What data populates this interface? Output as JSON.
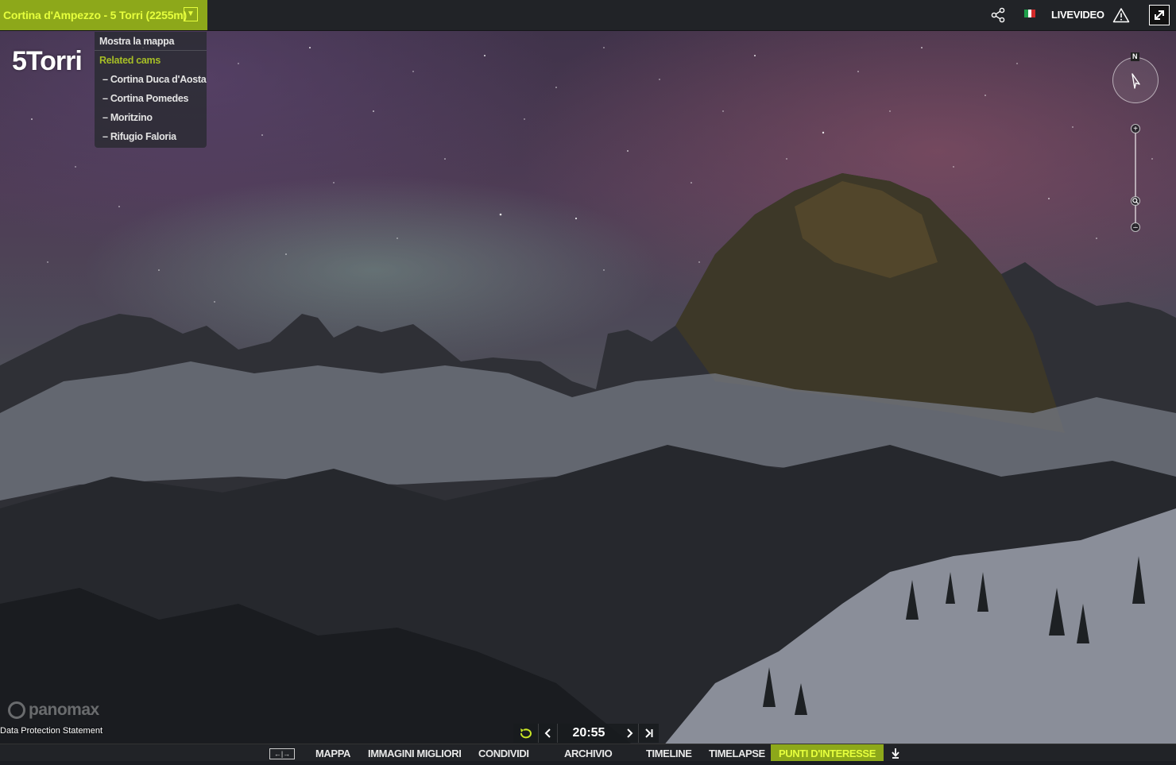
{
  "header": {
    "title": "Cortina d'Ampezzo - 5 Torri (2255m)",
    "livevideo_label": "LIVEVIDEO",
    "icons": {
      "dropdown": "chevron-down-icon",
      "share": "share-icon",
      "language": "italian-flag-icon",
      "warning": "warning-icon",
      "fullscreen": "fullscreen-icon"
    }
  },
  "menu": {
    "show_map": "Mostra la mappa",
    "related_title": "Related cams",
    "related_cams": [
      "– Cortina Duca d'Aosta",
      "– Cortina Pomedes",
      "– Moritzino",
      "– Rifugio Faloria"
    ]
  },
  "cam_logo": "5Torri",
  "compass": {
    "north_label": "N"
  },
  "branding": {
    "logo_text": "panomax",
    "data_protection": "Data Protection Statement"
  },
  "time_controls": {
    "time": "20:55"
  },
  "nav": {
    "items": [
      "MAPPA",
      "IMMAGINI MIGLIORI",
      "CONDIVIDI",
      "ARCHIVIO",
      "TIMELINE",
      "TIMELAPSE",
      "PUNTI D'INTERESSE"
    ],
    "active_item": "PUNTI D'INTERESSE"
  },
  "colors": {
    "accent": "#8da81a",
    "accent_text": "#e6ff3d",
    "bar_bg": "#212327"
  }
}
